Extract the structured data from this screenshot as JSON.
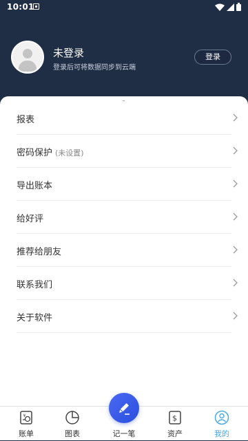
{
  "status_bar": {
    "time": "10:01"
  },
  "profile": {
    "name": "未登录",
    "subtitle": "登录后可将数据同步到云端",
    "login_button": "登录"
  },
  "menu": [
    {
      "label": "报表",
      "sub": ""
    },
    {
      "label": "密码保护",
      "sub": "(未设置)"
    },
    {
      "label": "导出账本",
      "sub": ""
    },
    {
      "label": "给好评",
      "sub": ""
    },
    {
      "label": "推荐给朋友",
      "sub": ""
    },
    {
      "label": "联系我们",
      "sub": ""
    },
    {
      "label": "关于软件",
      "sub": ""
    }
  ],
  "tabbar": {
    "tabs": [
      {
        "label": "账单",
        "icon": "bill-icon"
      },
      {
        "label": "图表",
        "icon": "pie-chart-icon"
      },
      {
        "label": "记一笔",
        "icon": "pen-icon"
      },
      {
        "label": "资产",
        "icon": "dollar-icon"
      },
      {
        "label": "我的",
        "icon": "user-icon"
      }
    ],
    "active": "我的"
  },
  "colors": {
    "header_bg": "#1f2d45",
    "accent": "#4aa8e5",
    "fab": "#2f55e6"
  }
}
